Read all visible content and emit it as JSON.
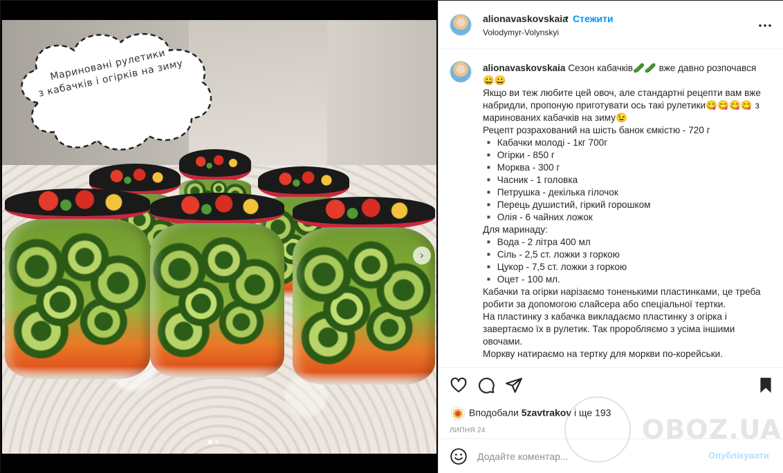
{
  "photo": {
    "overlay_text_line1": "Мариновані рулетики",
    "overlay_text_line2": "з кабачків і огірків на зиму",
    "next_arrow": "›"
  },
  "header": {
    "username": "alionavaskovskaia",
    "separator": "•",
    "follow_label": "Стежити",
    "location": "Volodymyr-Volynskyi",
    "more_icon": "more-options-icon"
  },
  "caption": {
    "username": "alionavaskovskaia",
    "lines": [
      "Сезон кабачків🥒🥒 вже давно розпочався😀😀",
      "Якщо ви теж любите цей овоч, але стандартні рецепти вам вже набридли, пропоную приготувати ось такі рулетики😋😋😋😋 з маринованих кабачків на зиму😉",
      "Рецепт розрахований на шість банок ємкістю - 720 г",
      "▪️ Кабачки молоді - 1кг 700г",
      "▪️ Огірки - 850 г",
      "▪️ Морква - 300 г",
      "▪️ Часник - 1 головка",
      "▪️ Петрушка - декілька гілочок",
      "▪️ Перець душистий, гіркий горошком",
      "▪️ Олія - 6 чайних ложок",
      "Для маринаду:",
      "▪️ Вода - 2 літра 400 мл",
      "▪️ Сіль - 2,5 ст. ложки з горкою",
      "▪️ Цукор - 7,5 ст. ложки з горкою",
      "▪️ Оцет - 100 мл.",
      "Кабачки та огірки нарізаємо тоненькими пластинками, це треба робити за допомогою слайсера або спеціальної тертки.",
      "На пластинку з кабачка викладаємо пластинку з огірка і завертаємо їх в рулетик. Так проробляємо з усіма іншими овочами.",
      "Моркву натираємо на тертку для моркви по-корейськи."
    ]
  },
  "actions": {
    "like_icon": "heart-icon",
    "comment_icon": "comment-icon",
    "share_icon": "send-icon",
    "save_icon": "bookmark-icon"
  },
  "likes": {
    "prefix": "Вподобали",
    "user": "5zavtrakov",
    "suffix": "і ще 193"
  },
  "date": "ЛИПНЯ 24",
  "comment_box": {
    "emoji_icon": "emoji-icon",
    "placeholder": "Додайте коментар...",
    "publish_label": "Опублікувати"
  },
  "watermark": "OBOZ.UA"
}
